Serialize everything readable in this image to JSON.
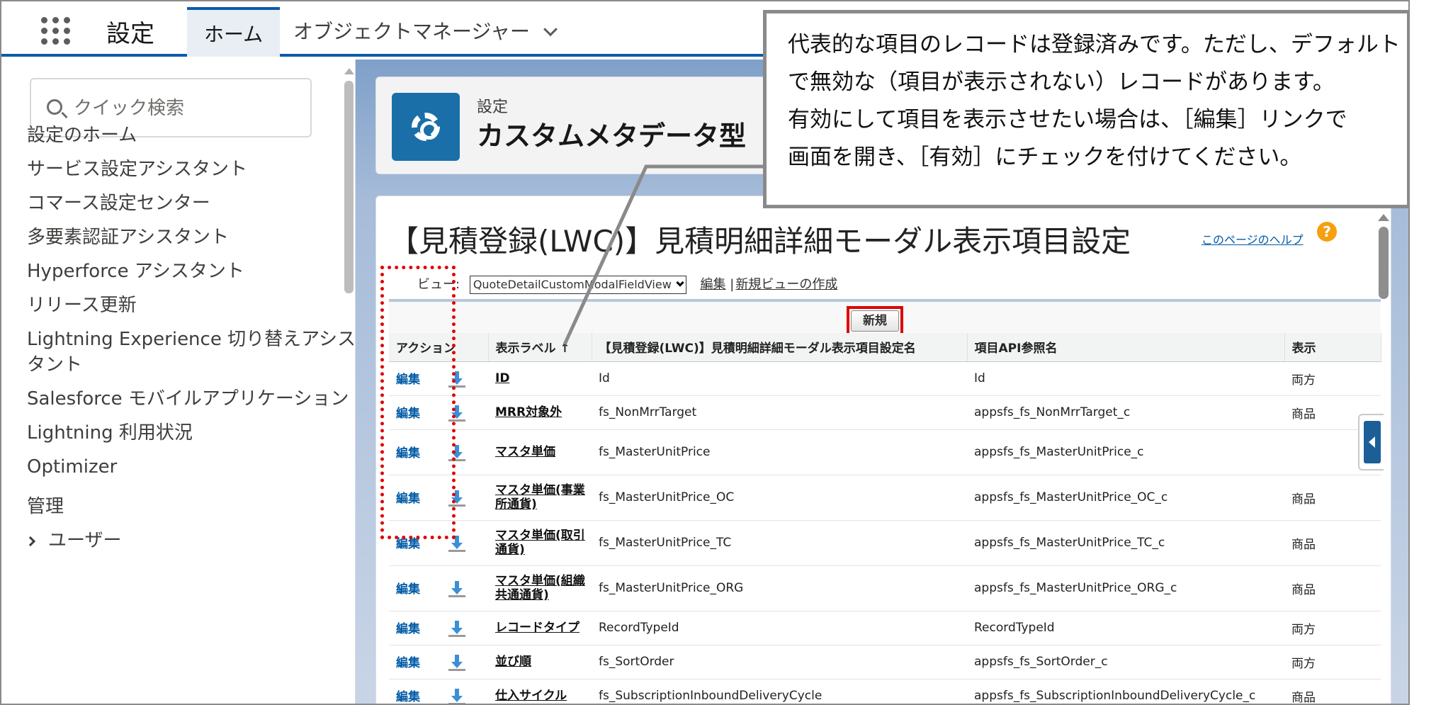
{
  "topbar": {
    "app_name": "設定",
    "tabs": [
      {
        "label": "ホーム"
      },
      {
        "label": "オブジェクトマネージャー"
      }
    ]
  },
  "sidebar": {
    "search_placeholder": "クイック検索",
    "items": [
      {
        "label": "設定のホーム"
      },
      {
        "label": "サービス設定アシスタント"
      },
      {
        "label": "コマース設定センター"
      },
      {
        "label": "多要素認証アシスタント"
      },
      {
        "label": "Hyperforce アシスタント"
      },
      {
        "label": "リリース更新"
      },
      {
        "label": "Lightning Experience 切り替えアシス"
      },
      {
        "label": "タント"
      },
      {
        "label": "Salesforce モバイルアプリケーション"
      },
      {
        "label": "Lightning 利用状況"
      },
      {
        "label": "Optimizer"
      },
      {
        "label": "管理"
      },
      {
        "label": "ユーザー"
      }
    ]
  },
  "header": {
    "breadcrumb": "設定",
    "type": "カスタムメタデータ型"
  },
  "page": {
    "title": "【見積登録(LWC)】見積明細詳細モーダル表示項目設定",
    "help_link": "このページのヘルプ",
    "help_icon": "?",
    "view_label": "ビュー:",
    "view_value": "QuoteDetailCustomModalFieldView",
    "edit_link": "編集",
    "separator": "|",
    "new_view_link": "新規ビューの作成",
    "new_button": "新規"
  },
  "table": {
    "headers": [
      "アクション",
      "表示ラベル ↑",
      "【見積登録(LWC)】見積明細詳細モーダル表示項目設定名",
      "項目API参照名",
      "表示"
    ],
    "rows": [
      {
        "action": "編集",
        "label": "ID",
        "name": "Id",
        "api": "Id",
        "display": "両方"
      },
      {
        "action": "編集",
        "label": "MRR対象外",
        "name": "fs_NonMrrTarget",
        "api": "appsfs_fs_NonMrrTarget_c",
        "display": "商品"
      },
      {
        "action": "編集",
        "label": "マスタ単価",
        "name": "fs_MasterUnitPrice",
        "api": "appsfs_fs_MasterUnitPrice_c",
        "display": ""
      },
      {
        "action": "編集",
        "label": "マスタ単価(事業所通貨)",
        "name": "fs_MasterUnitPrice_OC",
        "api": "appsfs_fs_MasterUnitPrice_OC_c",
        "display": "商品"
      },
      {
        "action": "編集",
        "label": "マスタ単価(取引通貨)",
        "name": "fs_MasterUnitPrice_TC",
        "api": "appsfs_fs_MasterUnitPrice_TC_c",
        "display": "商品"
      },
      {
        "action": "編集",
        "label": "マスタ単価(組織共通通貨)",
        "name": "fs_MasterUnitPrice_ORG",
        "api": "appsfs_fs_MasterUnitPrice_ORG_c",
        "display": "商品"
      },
      {
        "action": "編集",
        "label": "レコードタイプ",
        "name": "RecordTypeId",
        "api": "RecordTypeId",
        "display": "両方"
      },
      {
        "action": "編集",
        "label": "並び順",
        "name": "fs_SortOrder",
        "api": "appsfs_fs_SortOrder_c",
        "display": "両方"
      },
      {
        "action": "編集",
        "label": "仕入サイクル",
        "name": "fs_SubscriptionInboundDeliveryCycle",
        "api": "appsfs_fs_SubscriptionInboundDeliveryCycle_c",
        "display": "商品"
      }
    ]
  },
  "callout": {
    "lines": [
      "代表的な項目のレコードは登録済みです。ただし、デフォルト",
      "で無効な（項目が表示されない）レコードがあります。",
      "有効にして項目を表示させたい場合は、［編集］リンクで",
      "画面を開き、［有効］にチェックを付けてください。"
    ]
  },
  "colors": {
    "accent": "#0b5cab",
    "highlight_red": "#e00000",
    "link": "#015ba7",
    "help_icon": "#f5a011"
  }
}
